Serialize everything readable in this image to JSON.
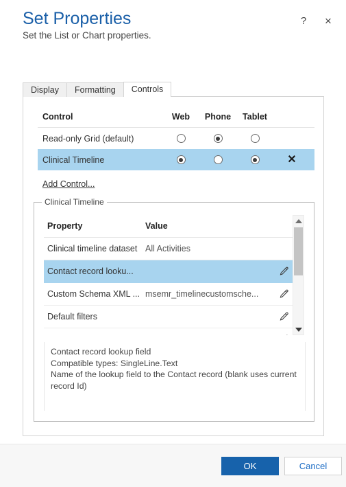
{
  "header": {
    "title": "Set Properties",
    "subtitle": "Set the List or Chart properties.",
    "help_icon": "?",
    "close_icon": "×"
  },
  "tabs": [
    {
      "label": "Display",
      "active": false
    },
    {
      "label": "Formatting",
      "active": false
    },
    {
      "label": "Controls",
      "active": true
    }
  ],
  "controls_table": {
    "headers": {
      "control": "Control",
      "web": "Web",
      "phone": "Phone",
      "tablet": "Tablet"
    },
    "rows": [
      {
        "name": "Read-only Grid (default)",
        "web": false,
        "phone": true,
        "tablet": false,
        "selected": false,
        "deletable": false
      },
      {
        "name": "Clinical Timeline",
        "web": true,
        "phone": false,
        "tablet": true,
        "selected": true,
        "deletable": true,
        "delete_icon": "✕"
      }
    ],
    "add_control_link": "Add Control..."
  },
  "group": {
    "legend": "Clinical Timeline",
    "property_grid": {
      "headers": {
        "property": "Property",
        "value": "Value"
      },
      "rows": [
        {
          "property": "Clinical timeline dataset",
          "value": "All Activities",
          "editable": false,
          "selected": false
        },
        {
          "property": "Contact record looku...",
          "value": "",
          "editable": true,
          "selected": true
        },
        {
          "property": "Custom Schema XML ...",
          "value": "msemr_timelinecustomsche...",
          "editable": true,
          "selected": false
        },
        {
          "property": "Default filters",
          "value": "",
          "editable": true,
          "selected": false
        },
        {
          "property": "",
          "value": "",
          "editable": true,
          "selected": false
        }
      ]
    },
    "scrollbar": {
      "up_arrow": "up-arrow",
      "down_arrow": "down-arrow"
    },
    "description": {
      "line1": "Contact record lookup field",
      "line2": "Compatible types: SingleLine.Text",
      "line3": "Name of the lookup field to the Contact record (blank uses current record Id)"
    }
  },
  "footer": {
    "ok_label": "OK",
    "cancel_label": "Cancel"
  },
  "colors": {
    "title_blue": "#1a5fa8",
    "selection_blue": "#a8d4ef",
    "primary_button": "#1762ab",
    "link_blue": "#1a6bc4"
  }
}
